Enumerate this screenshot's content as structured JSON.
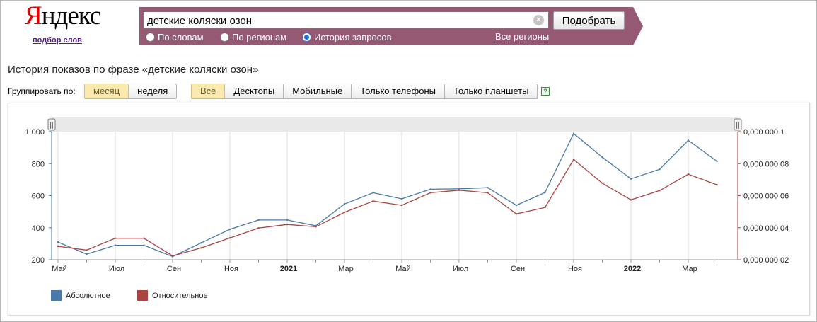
{
  "logo": {
    "first_letter": "Я",
    "rest": "ндекс",
    "subtitle": "подбор слов"
  },
  "search": {
    "value": "детские коляски озон",
    "clear_icon": "×",
    "submit_label": "Подобрать"
  },
  "radios": [
    {
      "label": "По словам",
      "checked": false
    },
    {
      "label": "По регионам",
      "checked": false
    },
    {
      "label": "История запросов",
      "checked": true
    }
  ],
  "regions_link": "Все регионы",
  "page_title": "История показов по фразе «детские коляски озон»",
  "group": {
    "label": "Группировать по:",
    "options": [
      {
        "label": "месяц",
        "active": true
      },
      {
        "label": "неделя",
        "active": false
      }
    ]
  },
  "devices": [
    {
      "label": "Все",
      "active": true
    },
    {
      "label": "Десктопы",
      "active": false
    },
    {
      "label": "Мобильные",
      "active": false
    },
    {
      "label": "Только телефоны",
      "active": false
    },
    {
      "label": "Только планшеты",
      "active": false
    }
  ],
  "help_icon": "?",
  "range_handle": "||",
  "colors": {
    "header_bg": "#955973",
    "absolute": "#4a79a8",
    "relative": "#a94442",
    "active_btn": "#fbeab0"
  },
  "legend": [
    {
      "name": "Абсолютное",
      "color": "#4a79a8"
    },
    {
      "name": "Относительное",
      "color": "#a94442"
    }
  ],
  "chart_data": {
    "type": "line",
    "x": [
      "2020-05",
      "2020-06",
      "2020-07",
      "2020-08",
      "2020-09",
      "2020-10",
      "2020-11",
      "2020-12",
      "2021-01",
      "2021-02",
      "2021-03",
      "2021-04",
      "2021-05",
      "2021-06",
      "2021-07",
      "2021-08",
      "2021-09",
      "2021-10",
      "2021-11",
      "2021-12",
      "2022-01",
      "2022-02",
      "2022-03",
      "2022-04"
    ],
    "x_tick_labels": [
      {
        "label": "Май",
        "index": 0,
        "bold": false
      },
      {
        "label": "Июл",
        "index": 2,
        "bold": false
      },
      {
        "label": "Сен",
        "index": 4,
        "bold": false
      },
      {
        "label": "Ноя",
        "index": 6,
        "bold": false
      },
      {
        "label": "2021",
        "index": 8,
        "bold": true
      },
      {
        "label": "Мар",
        "index": 10,
        "bold": false
      },
      {
        "label": "Май",
        "index": 12,
        "bold": false
      },
      {
        "label": "Июл",
        "index": 14,
        "bold": false
      },
      {
        "label": "Сен",
        "index": 16,
        "bold": false
      },
      {
        "label": "Ноя",
        "index": 18,
        "bold": false
      },
      {
        "label": "2022",
        "index": 20,
        "bold": true
      },
      {
        "label": "Мар",
        "index": 22,
        "bold": false
      }
    ],
    "y_left": {
      "ticks": [
        "1 000",
        "800",
        "600",
        "400",
        "200"
      ],
      "values": [
        1000,
        800,
        600,
        400,
        200
      ],
      "ylim": [
        200,
        1000
      ]
    },
    "y_right": {
      "ticks": [
        "0,000 000 1",
        "0,000 000 08",
        "0,000 000 06",
        "0,000 000 04",
        "0,000 000 02"
      ],
      "values": [
        1e-07,
        8e-08,
        6e-08,
        4e-08,
        2e-08
      ],
      "ylim": [
        2e-08,
        1e-07
      ]
    },
    "series": [
      {
        "name": "Абсолютное",
        "axis": "left",
        "values": [
          310,
          235,
          290,
          290,
          220,
          305,
          390,
          448,
          448,
          412,
          548,
          618,
          580,
          640,
          643,
          650,
          540,
          620,
          988,
          840,
          705,
          765,
          945,
          815
        ]
      },
      {
        "name": "Относительное",
        "axis": "right",
        "values": [
          2.84e-08,
          2.6e-08,
          3.34e-08,
          3.34e-08,
          2.24e-08,
          2.74e-08,
          3.36e-08,
          3.98e-08,
          4.2e-08,
          4.06e-08,
          4.96e-08,
          5.66e-08,
          5.4e-08,
          6.18e-08,
          6.34e-08,
          6.18e-08,
          4.86e-08,
          5.26e-08,
          8.26e-08,
          6.78e-08,
          5.74e-08,
          6.32e-08,
          7.34e-08,
          6.68e-08
        ]
      }
    ],
    "grid": true,
    "legend_position": "bottom-left"
  }
}
